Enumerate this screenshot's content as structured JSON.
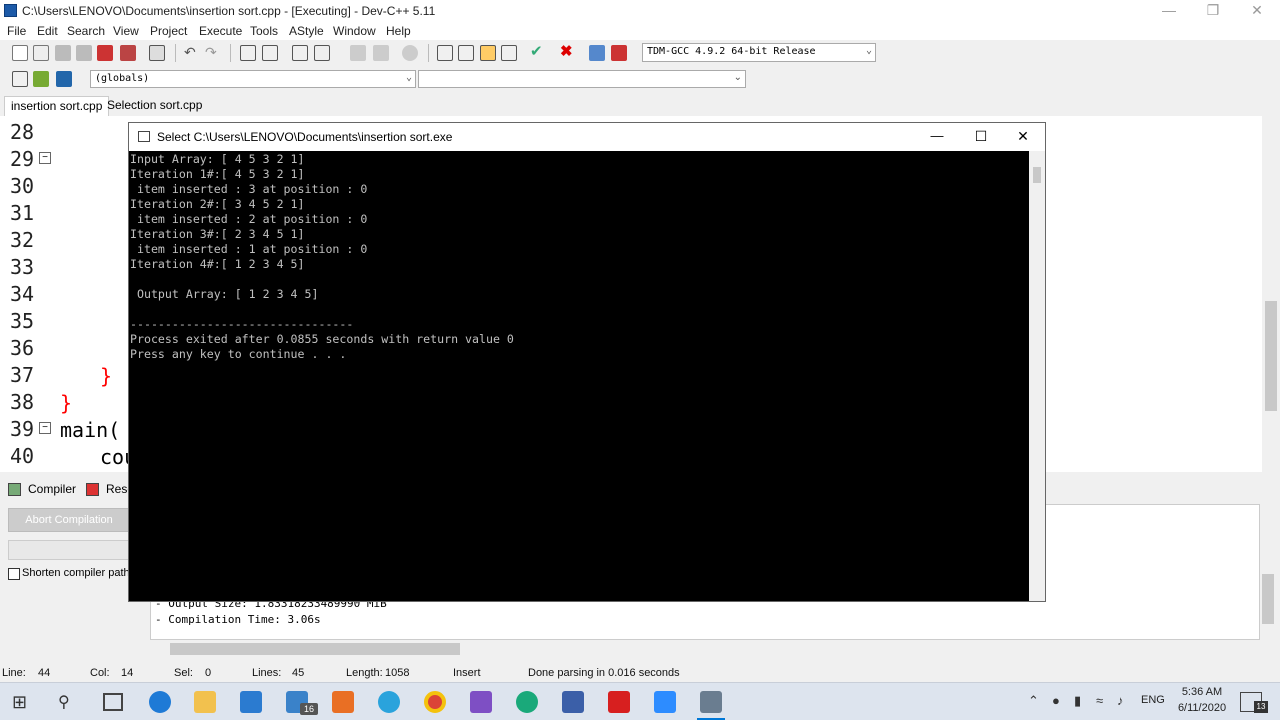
{
  "window": {
    "title": "C:\\Users\\LENOVO\\Documents\\insertion sort.cpp - [Executing] - Dev-C++ 5.11"
  },
  "menu": [
    "File",
    "Edit",
    "Search",
    "View",
    "Project",
    "Execute",
    "Tools",
    "AStyle",
    "Window",
    "Help"
  ],
  "toolbar": {
    "compiler": "TDM-GCC 4.9.2 64-bit Release",
    "scope": "(globals)"
  },
  "tabs": [
    "insertion sort.cpp",
    "Selection sort.cpp"
  ],
  "editor": {
    "line_numbers": [
      "28",
      "29",
      "30",
      "31",
      "32",
      "33",
      "34",
      "35",
      "36",
      "37",
      "38",
      "39",
      "40"
    ],
    "code": {
      "l37": "}",
      "l38": "}",
      "l39": "main(",
      "l40": "cou"
    }
  },
  "bottom": {
    "tabs": [
      "Compiler",
      "Reso"
    ],
    "abort_button": "Abort Compilation",
    "shorten_label": "Shorten compiler path",
    "log": [
      "- Output Size: 1.83318233489990 MiB",
      "- Compilation Time: 3.06s"
    ]
  },
  "console": {
    "title": "Select C:\\Users\\LENOVO\\Documents\\insertion sort.exe",
    "lines": [
      "Input Array: [ 4 5 3 2 1]",
      "Iteration 1#:[ 4 5 3 2 1]",
      " item inserted : 3 at position : 0",
      "Iteration 2#:[ 3 4 5 2 1]",
      " item inserted : 2 at position : 0",
      "Iteration 3#:[ 2 3 4 5 1]",
      " item inserted : 1 at position : 0",
      "Iteration 4#:[ 1 2 3 4 5]",
      "",
      " Output Array: [ 1 2 3 4 5]",
      "",
      "--------------------------------",
      "Process exited after 0.0855 seconds with return value 0",
      "Press any key to continue . . ."
    ]
  },
  "status": {
    "line_label": "Line:",
    "line_value": "44",
    "col_label": "Col:",
    "col_value": "14",
    "sel_label": "Sel:",
    "sel_value": "0",
    "lines_label": "Lines:",
    "lines_value": "45",
    "length_label": "Length:",
    "length_value": "1058",
    "mode": "Insert",
    "message": "Done parsing in 0.016 seconds"
  },
  "taskbar": {
    "badge": "16",
    "lang": "ENG",
    "time": "5:36 AM",
    "date": "6/11/2020",
    "notifications": "13"
  },
  "colors": {
    "accent": "#0078d7",
    "code_brace": "#ff0000"
  }
}
